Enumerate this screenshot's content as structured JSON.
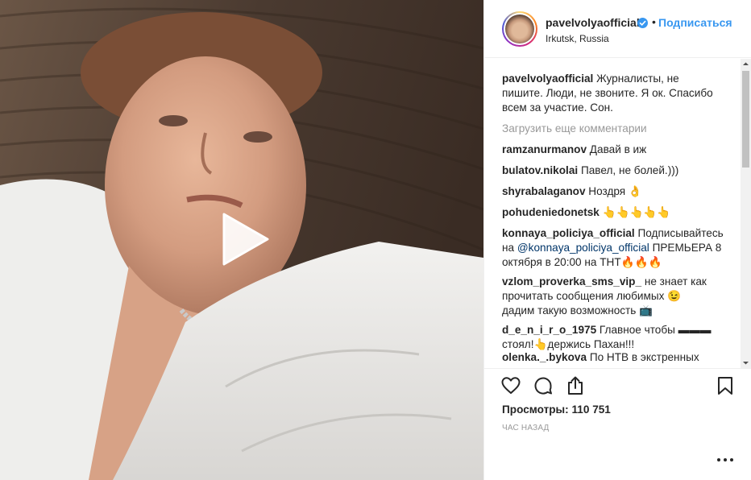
{
  "post": {
    "username": "pavelvolyaofficial",
    "dot": "•",
    "follow_label": "Подписаться",
    "location": "Irkutsk, Russia"
  },
  "caption": {
    "user": "pavelvolyaofficial",
    "line1": "Журналисты, не",
    "line2": "пишите. Люди, не звоните. Я ок. Спасибо",
    "line3": "всем за участие. Сон."
  },
  "load_more": "Загрузить еще комментарии",
  "comments": [
    {
      "user": "ramzanurmanov",
      "lines": [
        "Давай в иж"
      ]
    },
    {
      "user": "bulatov.nikolai",
      "lines": [
        "Павел, не болей.)))"
      ]
    },
    {
      "user": "shyrabalaganov",
      "lines": [
        "Ноздря 👌"
      ]
    },
    {
      "user": "pohudeniedonetsk",
      "lines": [
        "👆👆👆👆👆"
      ]
    },
    {
      "user": "konnaya_policiya_official",
      "lines": [
        "Подписывайтесь",
        "на ",
        "@konnaya_policiya_official",
        " ПРЕМЬЕРА 8",
        "октября в 20:00 на ТНТ🔥🔥🔥"
      ]
    },
    {
      "user": "vzlom_proverka_sms_vip_",
      "lines": [
        "не знает как",
        "прочитать сообщения любимых 😉",
        "дадим такую возможность 📺"
      ]
    },
    {
      "user": "d_e_n_i_r_o_1975",
      "lines": [
        "Главное чтобы ▬▬▬",
        "стоял!👆держись Пахан!!!"
      ]
    },
    {
      "user": "olenka._.bykova",
      "lines": [
        "По НТВ в экстренных"
      ]
    }
  ],
  "stats": {
    "views_label": "Просмотры:",
    "views_value": "110 751",
    "timestamp": "ЧАС НАЗАД"
  },
  "icons": {
    "like": "heart-icon",
    "comment": "comment-icon",
    "share": "share-icon",
    "save": "bookmark-icon",
    "more": "more-icon",
    "play": "play-icon",
    "verified": "verified-icon"
  },
  "colors": {
    "link": "#3897f0",
    "mention": "#003569",
    "muted": "#999999",
    "verified": "#3897f0"
  }
}
